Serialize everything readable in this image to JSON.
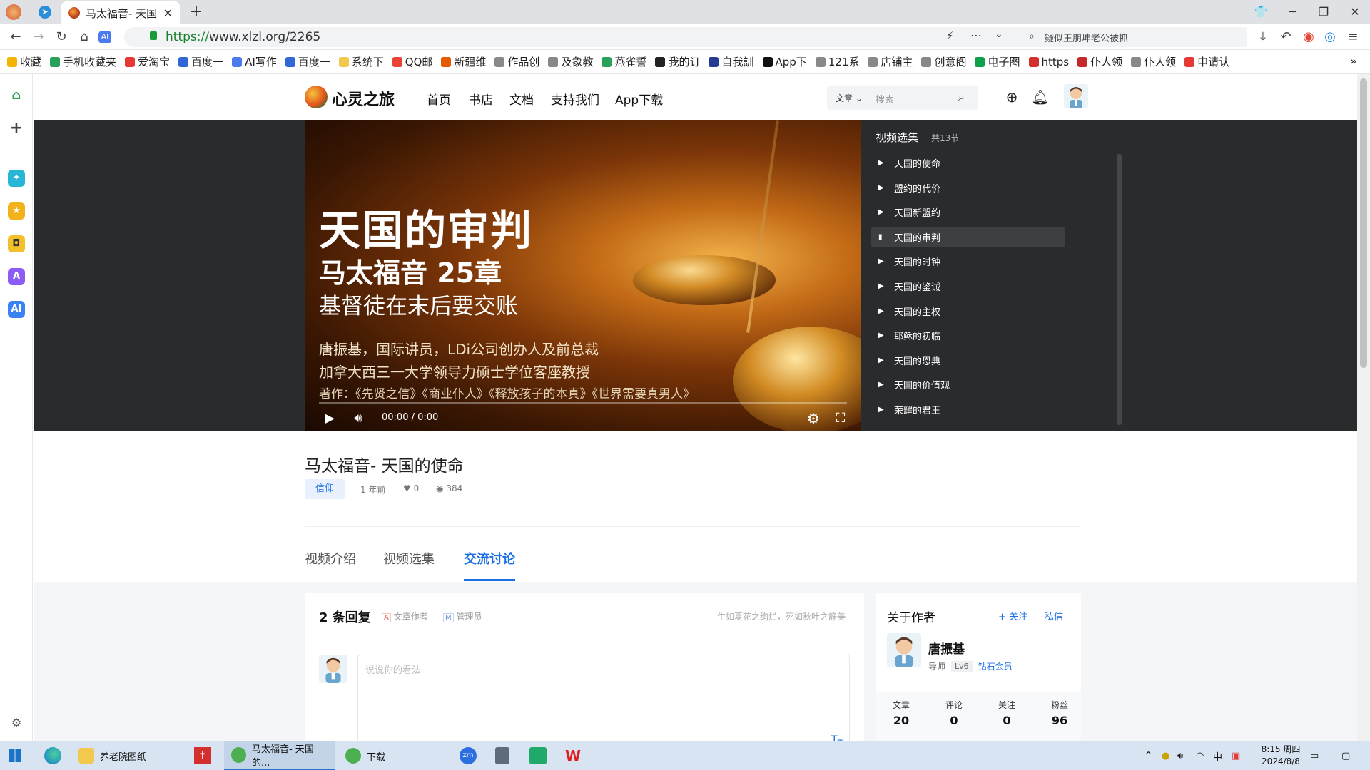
{
  "browser": {
    "tab_title": "马太福音- 天国",
    "url_scheme": "https://",
    "url_rest": "www.xlzl.org/2265",
    "search_text": "疑似王朋坤老公被抓",
    "bookmarks": [
      "收藏",
      "手机收藏夹",
      "爱淘宝",
      "百度一",
      "AI写作",
      "百度一",
      "系统下",
      "QQ邮",
      "新疆维",
      "作品创",
      "及象教",
      "燕雀誓",
      "我的订",
      "自我訓",
      "App下",
      "121系",
      "店铺主",
      "创意阁",
      "电子图",
      "https",
      "仆人领",
      "仆人领",
      "申请认"
    ]
  },
  "site": {
    "logo": "心灵之旅",
    "menu": [
      "首页",
      "书店",
      "文档",
      "支持我们",
      "App下载"
    ],
    "search_category": "文章",
    "search_placeholder": "搜索"
  },
  "video": {
    "title_line1": "天国的审判",
    "title_line2": "马太福音 25章",
    "title_line3": "基督徒在末后要交账",
    "credit1": "唐振基，国际讲员，LDi公司创办人及前总裁",
    "credit2": "加拿大西三一大学领导力硕士学位客座教授",
    "credit3": "著作：《先贤之信》《商业仆人》《释放孩子的本真》《世界需要真男人》",
    "time": "00:00 / 0:00"
  },
  "playlist": {
    "title": "视频选集",
    "count": "共13节",
    "items": [
      "天国的使命",
      "盟约的代价",
      "天国新盟约",
      "天国的审判",
      "天国的时钟",
      "天国的鉴诫",
      "天国的主权",
      "耶稣的初临",
      "天国的恩典",
      "天国的价值观",
      "荣耀的君王"
    ],
    "active_index": 3
  },
  "post": {
    "title": "马太福音- 天国的使命",
    "tag": "信仰",
    "time": "1 年前",
    "likes": "0",
    "views": "384",
    "tabs": [
      "视频介绍",
      "视频选集",
      "交流讨论"
    ],
    "active_tab": 2
  },
  "comments": {
    "title": "2 条回复",
    "badge_author": "文章作者",
    "badge_admin": "管理员",
    "motto": "生如夏花之绚烂，死如秋叶之静美",
    "placeholder": "说说你的看法"
  },
  "author": {
    "heading": "关于作者",
    "follow": "+ 关注",
    "message": "私信",
    "name": "唐振基",
    "role": "导师",
    "level": "Lv6",
    "vip": "钻石会员",
    "stats": [
      {
        "label": "文章",
        "value": "20"
      },
      {
        "label": "评论",
        "value": "0"
      },
      {
        "label": "关注",
        "value": "0"
      },
      {
        "label": "粉丝",
        "value": "96"
      }
    ]
  },
  "taskbar": {
    "items": [
      "养老院图纸",
      "马太福音- 天国的...",
      "下载"
    ],
    "ime": "中",
    "time": "8:15 周四",
    "date": "2024/8/8"
  },
  "colors": {
    "accent": "#1a6fe4",
    "player_bg": "#2a2b2d"
  }
}
